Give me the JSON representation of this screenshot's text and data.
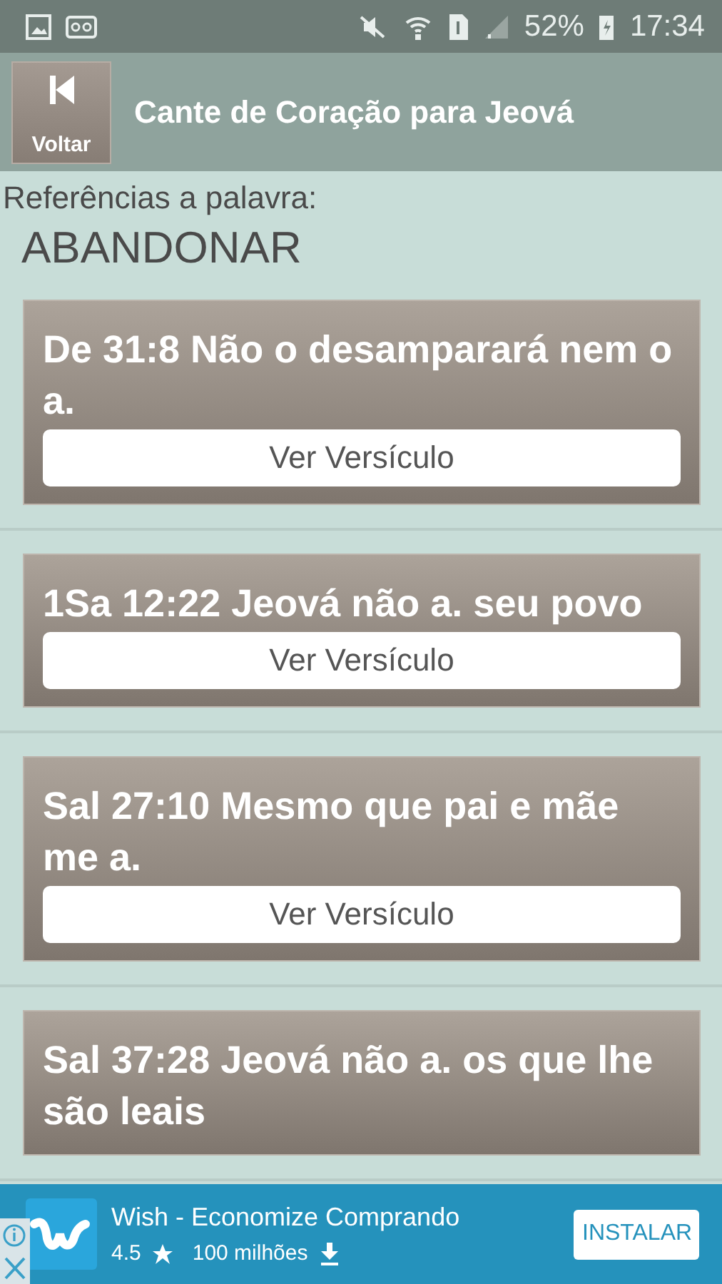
{
  "status_bar": {
    "battery": "52%",
    "time": "17:34"
  },
  "header": {
    "back_label": "Voltar",
    "title": "Cante de Coração para Jeová"
  },
  "heading": {
    "caption": "Referências a palavra:",
    "word": "ABANDONAR"
  },
  "references": [
    {
      "text": "De 31:8 Não o desamparará nem o a.",
      "button": "Ver Versículo"
    },
    {
      "text": "1Sa 12:22 Jeová não a. seu povo",
      "button": "Ver Versículo"
    },
    {
      "text": "Sal 27:10 Mesmo que pai e mãe me a.",
      "button": "Ver Versículo"
    },
    {
      "text": "Sal 37:28 Jeová não a. os que lhe são leais"
    }
  ],
  "ad": {
    "title": "Wish - Economize Comprando",
    "rating": "4.5",
    "downloads": "100 milhões",
    "button": "INSTALAR"
  }
}
